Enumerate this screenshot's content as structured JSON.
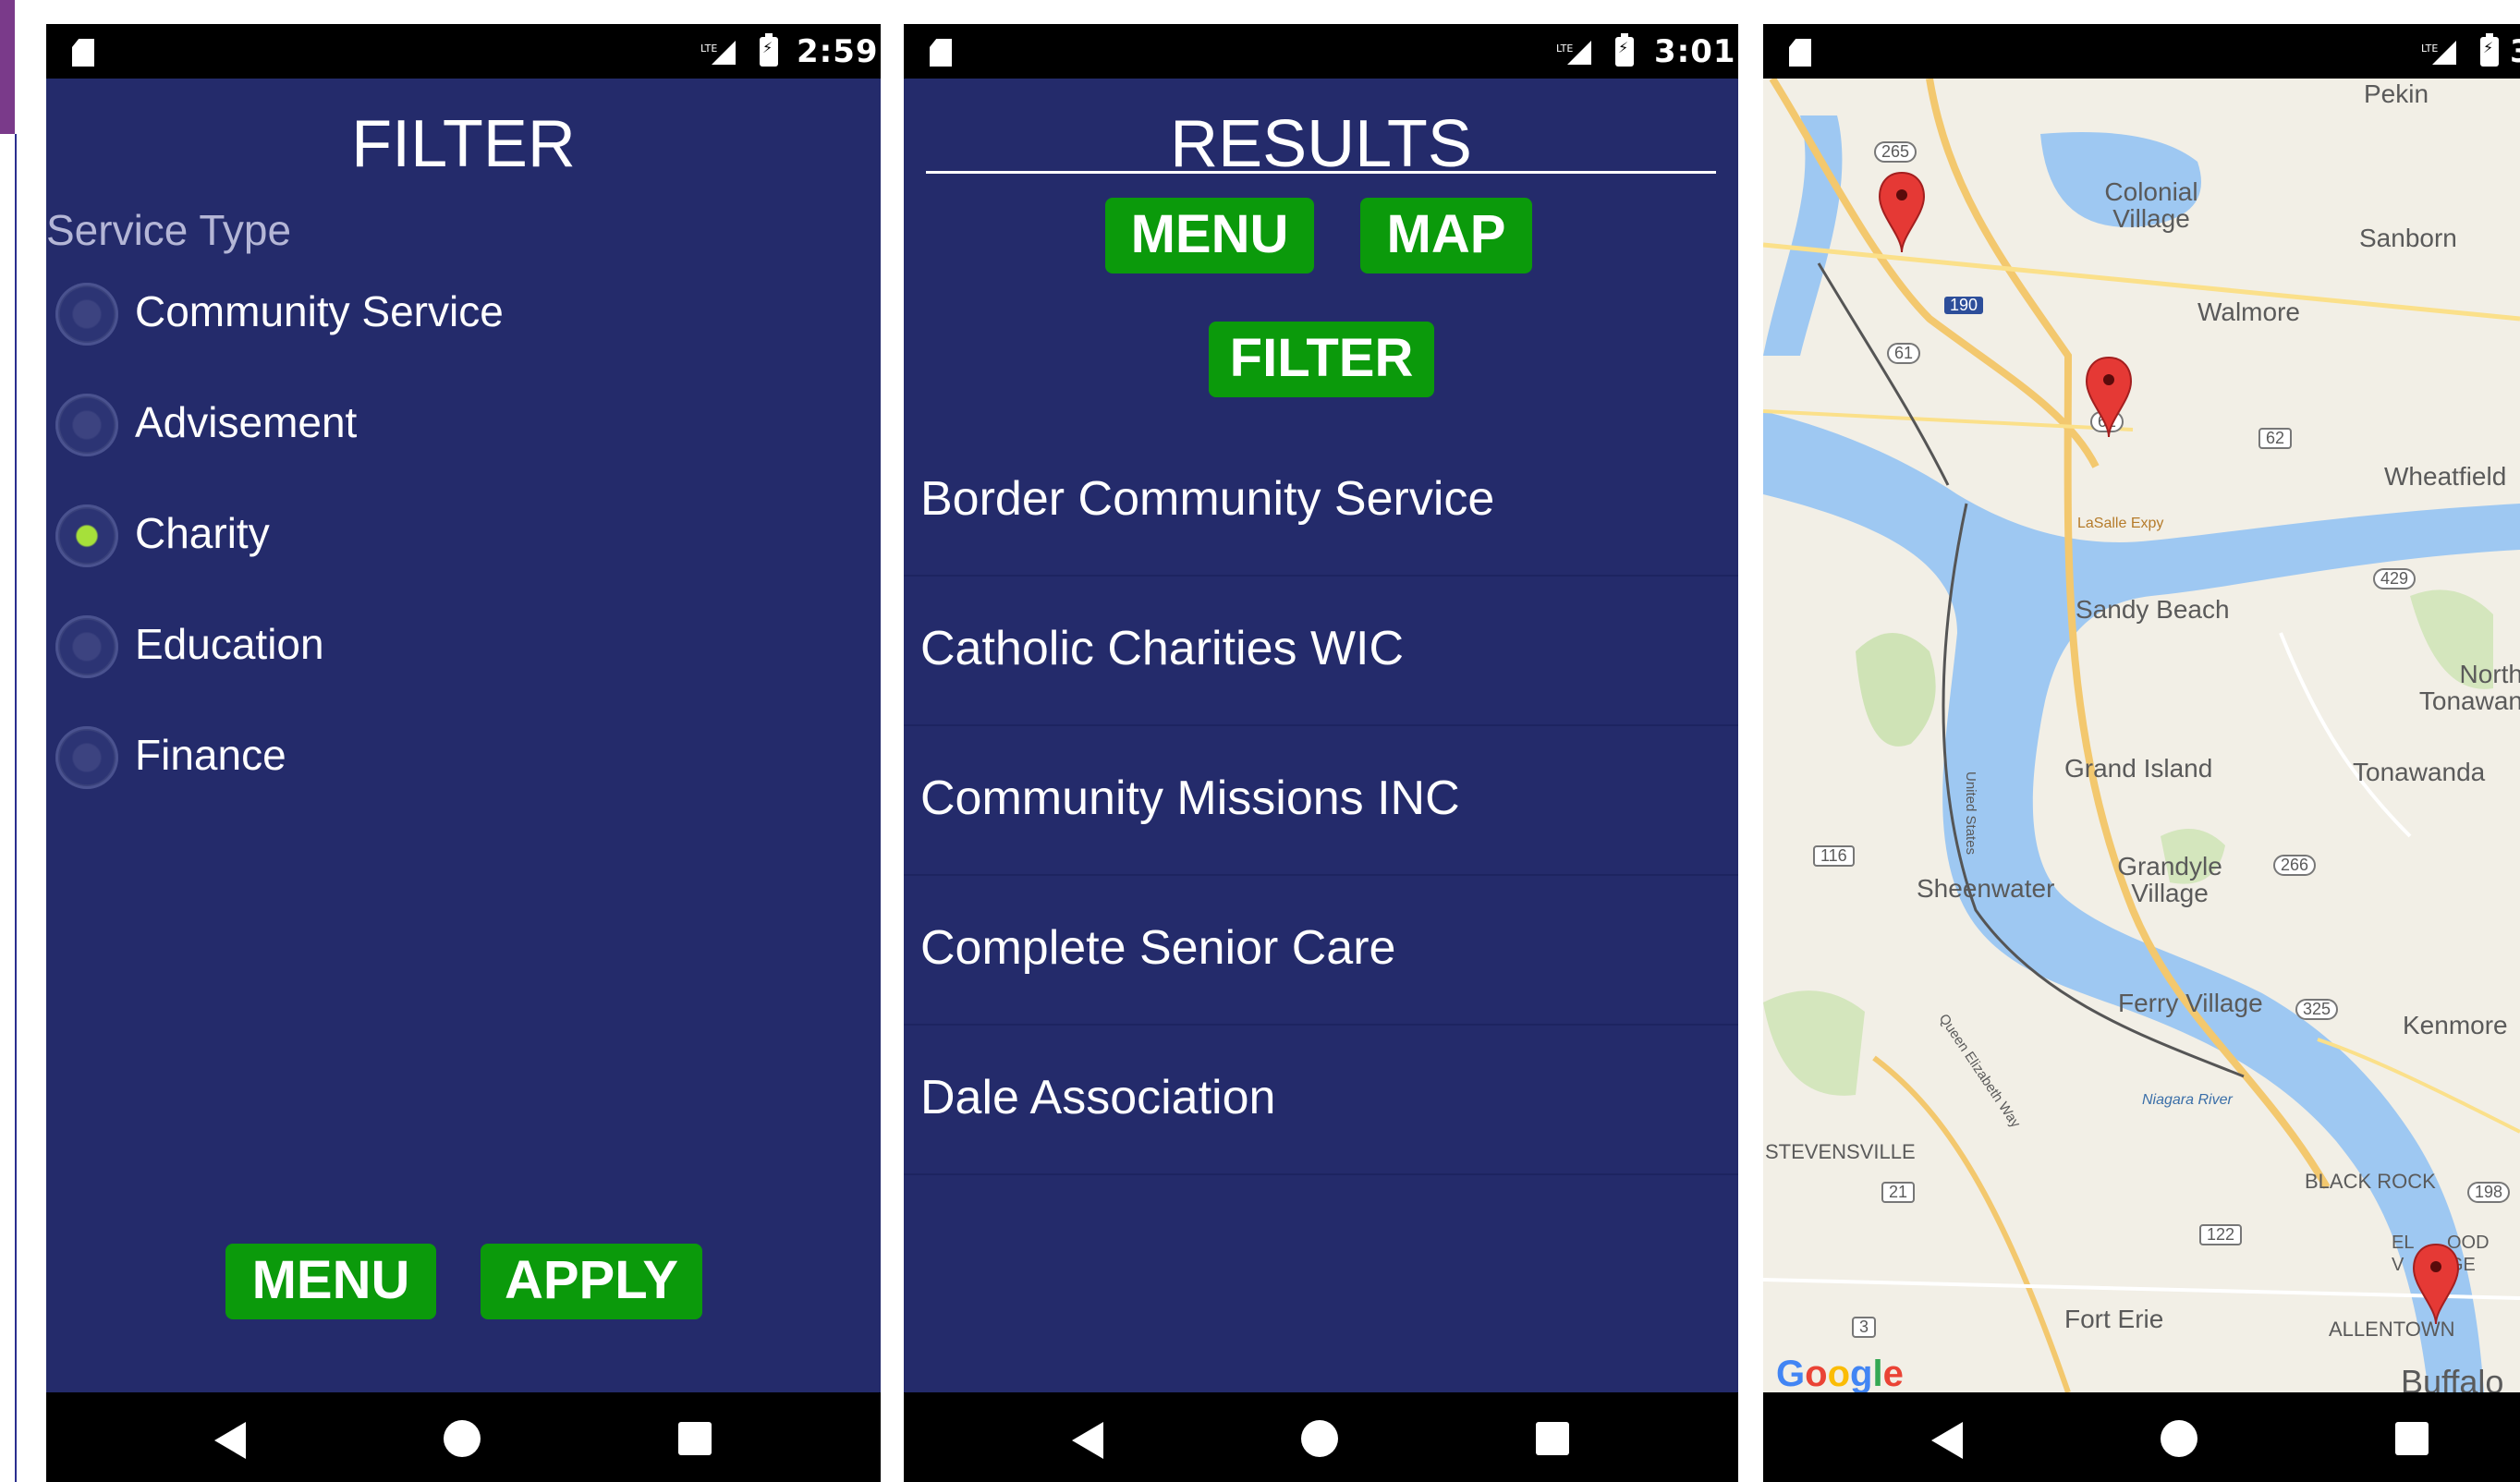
{
  "colors": {
    "screen_bg": "#242b6b",
    "button_green": "#0b9a0b",
    "radio_selected": "#a6e03a",
    "system_bar": "#000000"
  },
  "filter_screen": {
    "time": "2:59",
    "title": "FILTER",
    "section_label": "Service Type",
    "options": [
      {
        "label": "Community Service",
        "selected": false
      },
      {
        "label": "Advisement",
        "selected": false
      },
      {
        "label": "Charity",
        "selected": true
      },
      {
        "label": "Education",
        "selected": false
      },
      {
        "label": "Finance",
        "selected": false
      }
    ],
    "menu_label": "MENU",
    "apply_label": "APPLY"
  },
  "results_screen": {
    "time": "3:01",
    "title": "RESULTS",
    "menu_label": "MENU",
    "map_label": "MAP",
    "filter_label": "FILTER",
    "results": [
      "Border Community Service",
      "Catholic Charities WIC",
      "Community Missions INC",
      "Complete Senior Care",
      "Dale Association"
    ]
  },
  "map_screen": {
    "time_partial": "3",
    "places": [
      "Pekin",
      "Colonial Village",
      "Sanborn",
      "Walmore",
      "Wheatfield",
      "Sandy Beach",
      "North Tonawan",
      "Grand Island",
      "Tonawanda",
      "Grandyle Village",
      "Sheenwater",
      "Ferry Village",
      "Kenmore",
      "STEVENSVILLE",
      "BLACK ROCK",
      "Fort Erie",
      "ALLENTOWN",
      "Buffalo"
    ],
    "road_labels": {
      "ls": "LaSalle Expy",
      "niagara": "Niagara River",
      "qew": "Queen Elizabeth Way",
      "unitedstates": "United States",
      "elmwood_a": "EL",
      "elmwood_b": "OOD",
      "elmwood_c": "V",
      "elmwood_d": "GE"
    },
    "shields": [
      "265",
      "190",
      "61",
      "62",
      "62",
      "429",
      "116",
      "266",
      "325",
      "198",
      "21",
      "122",
      "3"
    ],
    "pins": 3,
    "logo": "Google"
  }
}
